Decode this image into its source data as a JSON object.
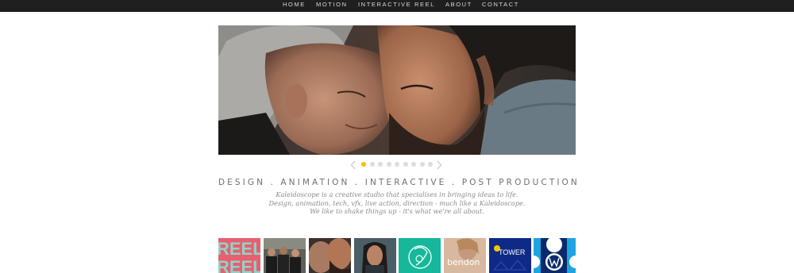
{
  "nav": {
    "items": [
      {
        "label": "HOME"
      },
      {
        "label": "MOTION"
      },
      {
        "label": "INTERACTIVE"
      },
      {
        "label": "REEL"
      },
      {
        "label": "ABOUT"
      },
      {
        "label": "CONTACT"
      }
    ]
  },
  "slider": {
    "slide_count": 9,
    "active_slide": 1,
    "prev_icon": "chevron-left-icon",
    "next_icon": "chevron-right-icon",
    "active_color": "#f2c200",
    "inactive_color": "#dcdcdc"
  },
  "intro": {
    "tagline": "DESIGN . ANIMATION . INTERACTIVE . POST PRODUCTION",
    "lines": [
      "Kaleidoscope is a creative studio that specialises in bringing ideas to life.",
      "Design, animation, tech, vfx, live action, direction - much like a Kaleidoscope.",
      "We like to shake things up - it's what we're all about."
    ]
  },
  "thumbnails": [
    {
      "name": "reel",
      "text": "REEL"
    },
    {
      "name": "rugby-team",
      "text": ""
    },
    {
      "name": "hongi-portrait",
      "text": ""
    },
    {
      "name": "girl-portrait",
      "text": ""
    },
    {
      "name": "teal-illustration",
      "text": ""
    },
    {
      "name": "bendon",
      "text": "bendon"
    },
    {
      "name": "tower",
      "text": "TOWER"
    },
    {
      "name": "volkswagen",
      "text": ""
    }
  ],
  "colors": {
    "nav_bg": "#1f1f1f",
    "nav_text": "#d9d9d9",
    "tagline": "#6f6f6f",
    "body_text": "#8a8a8a"
  }
}
